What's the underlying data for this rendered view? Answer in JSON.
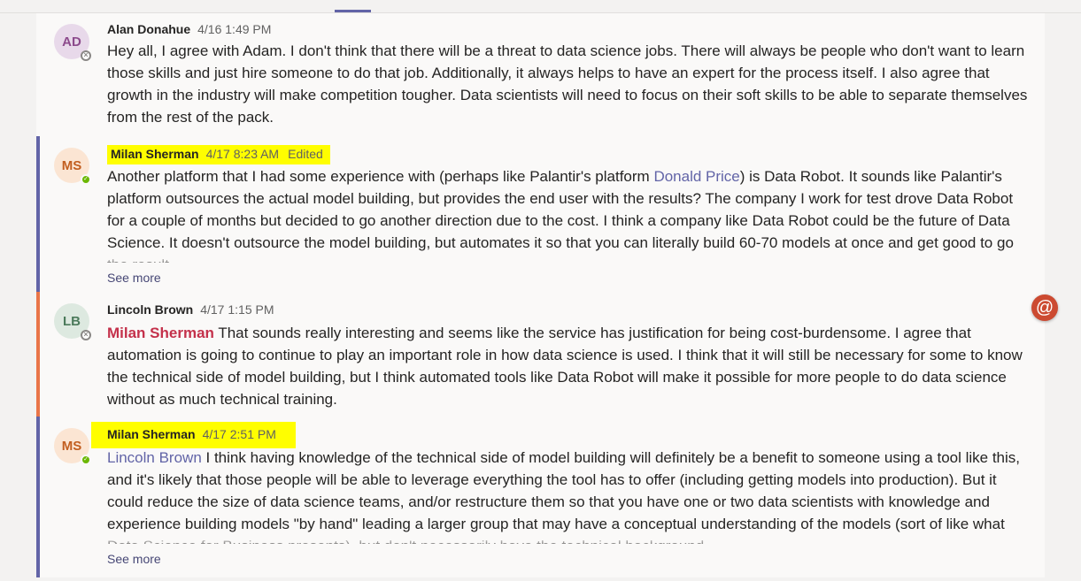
{
  "posts": [
    {
      "initials": "AD",
      "author": "Alan Donahue",
      "time": "4/16 1:49 PM",
      "edited": "",
      "mention": "",
      "text": "Hey all, I agree with Adam. I don't think that there will be a threat to data science jobs. There will always be people who don't want to learn those skills and just hire someone to do that job. Additionally, it always helps to have an expert for the process itself. I also agree that growth in the industry will make competition tougher. Data scientists will need to focus on their soft skills to be able to separate themselves from the rest of the pack.",
      "presence": "away",
      "accent": "#e8e1f0",
      "bar_color": ""
    },
    {
      "initials": "MS",
      "author": "Milan Sherman",
      "time": "4/17 8:23 AM",
      "edited": "Edited",
      "text_before": "Another platform that I had some experience with (perhaps like Palantir's platform ",
      "mention": "Donald Price",
      "text_after": ") is Data Robot.  It sounds like Palantir's platform outsources the actual model building, but provides the end user with the results?  The company I work for test drove Data Robot for a couple of months but decided to go another direction due to the cost.  I think a company like Data Robot could be the future of Data Science.  It doesn't outsource the model building, but automates it so that you can literally build 60-70 models at once and get good to go the result...",
      "see_more": "See more",
      "presence": "available",
      "bar_color": "#6264a7"
    },
    {
      "initials": "LB",
      "author": "Lincoln Brown",
      "time": "4/17 1:15 PM",
      "mention": "Milan Sherman",
      "text_after": " That sounds really interesting and seems like the service has justification for being cost-burdensome. I agree that automation is going to continue to play an important role in how data science is used. I think that it will still be necessary for some to know the technical side of model building, but I think automated tools like Data Robot will make it possible for more people to do data science without as much technical training.",
      "presence": "away",
      "bar_color": "#e97548"
    },
    {
      "initials": "MS",
      "author": "Milan Sherman",
      "time": "4/17 2:51 PM",
      "mention": "Lincoln Brown",
      "text_after": " I think having knowledge of the technical side of model building will definitely be a benefit to someone using a tool like this, and it's likely that those people will be able to leverage everything the tool has to offer (including getting models into production).  But it could reduce the size of data science teams, and/or restructure them so that you have one or two data scientists with knowledge and experience building models \"by hand\" leading a larger group that may have a conceptual understanding of the models (sort of like what Data Science for Business presents), but don't necessarily have the technical background.",
      "see_more": "See more",
      "presence": "available",
      "bar_color": "#6264a7"
    }
  ],
  "at_button": "@",
  "colors": {
    "brand": "#6264a7",
    "highlight": "#fffe00",
    "mention_self": "#c4314b"
  }
}
